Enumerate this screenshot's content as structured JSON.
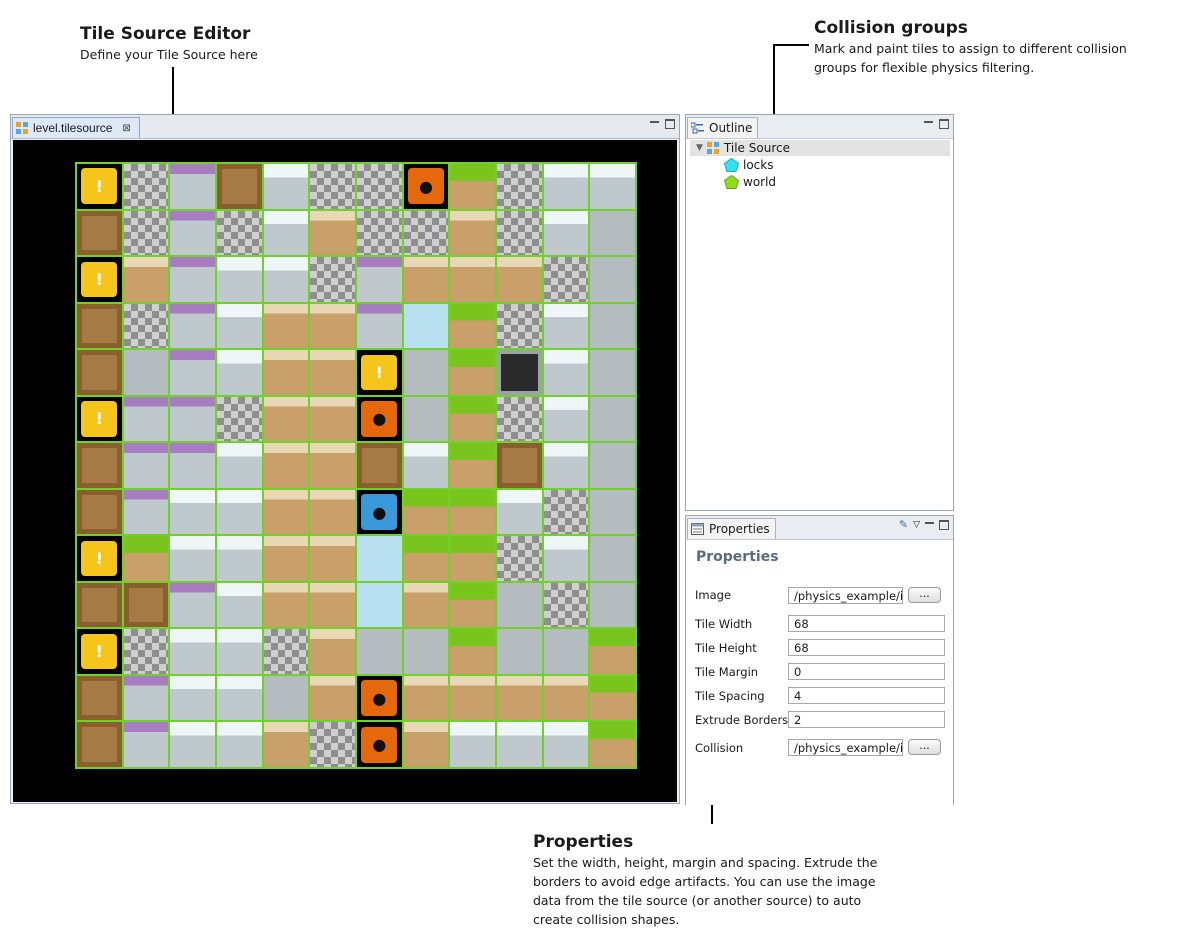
{
  "callouts": {
    "editor": {
      "title": "Tile Source Editor",
      "text": "Define your Tile Source here"
    },
    "collision": {
      "title": "Collision groups",
      "text_line1": "Mark and paint tiles to assign to different collision",
      "text_line2": "groups for flexible physics filtering."
    },
    "properties": {
      "title": "Properties",
      "text_line1": "Set the width, height, margin and spacing. Extrude the",
      "text_line2": "borders to avoid edge artifacts. You can use the image",
      "text_line3": "data from the tile source (or another source) to auto",
      "text_line4": "create collision shapes."
    }
  },
  "editor": {
    "tab_label": "level.tilesource",
    "tab_icon": "tilesource-icon",
    "close_icon": "close-icon"
  },
  "outline": {
    "tab_label": "Outline",
    "root_label": "Tile Source",
    "groups": [
      {
        "label": "locks",
        "color": "#35e0f2"
      },
      {
        "label": "world",
        "color": "#8fdc1e"
      }
    ]
  },
  "properties": {
    "tab_label": "Properties",
    "heading": "Properties",
    "fields": {
      "image": {
        "label": "Image",
        "value": "/physics_example/ir",
        "button": "..."
      },
      "tile_width": {
        "label": "Tile Width",
        "value": "68"
      },
      "tile_height": {
        "label": "Tile Height",
        "value": "68"
      },
      "tile_margin": {
        "label": "Tile Margin",
        "value": "0"
      },
      "tile_spacing": {
        "label": "Tile Spacing",
        "value": "4"
      },
      "extrude_borders": {
        "label": "Extrude Borders",
        "value": "2"
      },
      "collision": {
        "label": "Collision",
        "value": "/physics_example/ir",
        "button": "..."
      }
    }
  },
  "tile_grid": {
    "columns": 12,
    "rows": 13,
    "palette": {
      "C": "#c4c4c4",
      "S": "#b5bcbf",
      "W": "#c9a06a",
      "G": "#79c41d",
      "D": "#e0e8ea",
      "L": "#a67a45",
      "Y": "#f6c51b",
      "O": "#e5690c",
      "B": "#3a9ad9",
      "A": "#b8e0f0",
      "K": "#1e1e1e",
      "P": "#a87cc0"
    },
    "rows_map": [
      "YCPLDCCOGCDD",
      "LCPCDWCCWCDS",
      "YWPDDCPWWWCS",
      "LCPDWWPAGCDS",
      "LSPDWWYSGKDS",
      "YPPCWWOSGCDS",
      "LPPDWWLDGLDS",
      "LPDDWWBGGDCS",
      "YGDDWWAGGCDS",
      "LLPDWWAWGSCS",
      "YCDDCWSSGSSG",
      "LPDDSWOWWWWG",
      "LPDDWCOWDDDG"
    ]
  }
}
